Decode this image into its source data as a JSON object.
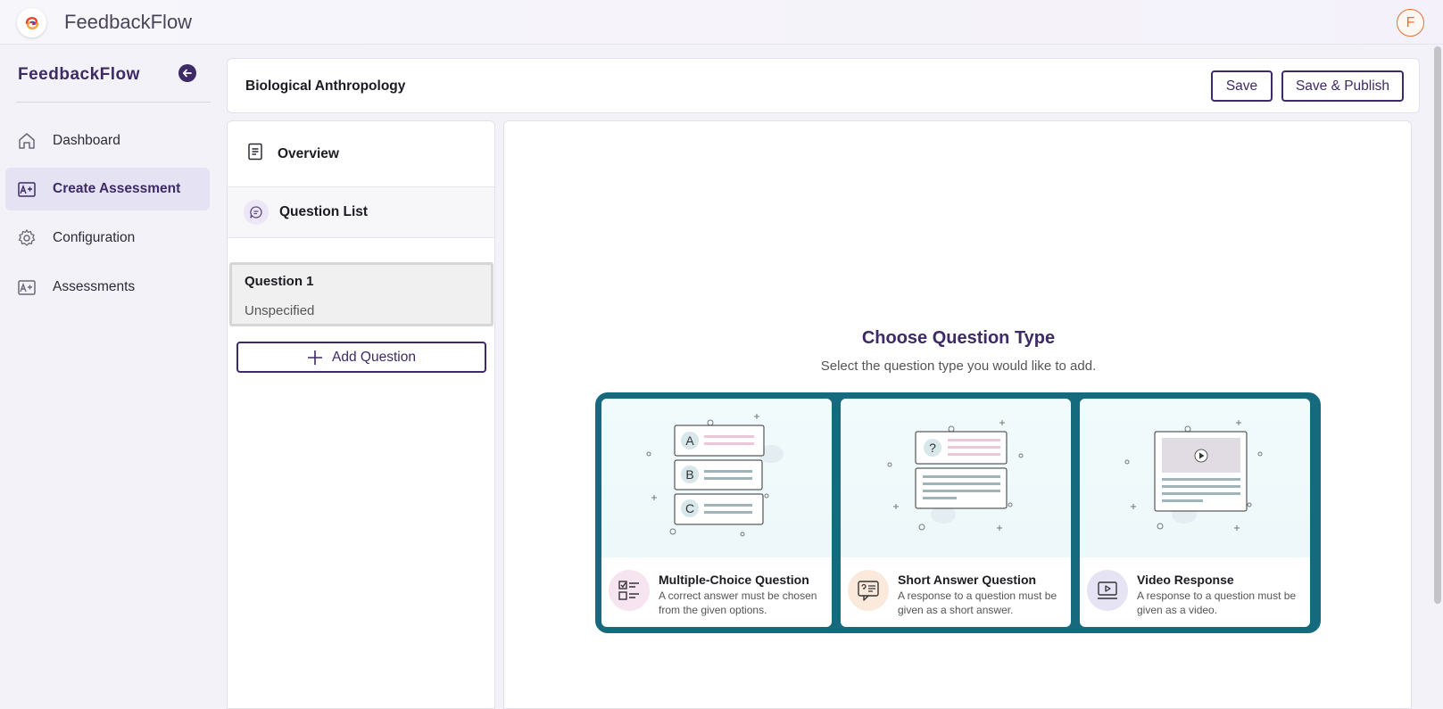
{
  "app": {
    "name": "FeedbackFlow",
    "avatar_initial": "F"
  },
  "sidebar": {
    "brand": "FeedbackFlow",
    "items": [
      {
        "label": "Dashboard",
        "icon": "home-icon",
        "active": false
      },
      {
        "label": "Create Assessment",
        "icon": "assessment-plus-icon",
        "active": true
      },
      {
        "label": "Configuration",
        "icon": "gear-icon",
        "active": false
      },
      {
        "label": "Assessments",
        "icon": "assessment-plus-icon",
        "active": false
      }
    ]
  },
  "header": {
    "title": "Biological Anthropology",
    "save_label": "Save",
    "publish_label": "Save & Publish"
  },
  "left_panel": {
    "overview_label": "Overview",
    "question_list_label": "Question List",
    "questions": [
      {
        "title": "Question 1",
        "type": "Unspecified"
      }
    ],
    "add_question_label": "Add Question"
  },
  "main": {
    "title": "Choose Question Type",
    "subtitle": "Select the question type you would like to add.",
    "types": [
      {
        "name": "Multiple-Choice Question",
        "description": "A correct answer must be chosen from the given options.",
        "icon": "checklist-icon",
        "icon_bg": "#f6e4f1"
      },
      {
        "name": "Short Answer Question",
        "description": "A response to a question must be given as a short answer.",
        "icon": "speech-bubble-icon",
        "icon_bg": "#fbeadb"
      },
      {
        "name": "Video Response",
        "description": "A response to a question must be given as a video.",
        "icon": "video-icon",
        "icon_bg": "#e6e4f4"
      }
    ],
    "mcq_options": [
      "A",
      "B",
      "C"
    ],
    "short_answer_symbol": "?"
  },
  "colors": {
    "primary": "#3d2a66",
    "accent_teal": "#156b7d",
    "avatar_orange": "#e0703a"
  }
}
